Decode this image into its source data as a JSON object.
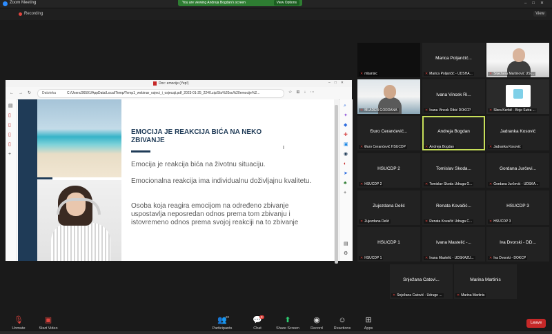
{
  "window": {
    "title": "Zoom Meeting"
  },
  "banner": {
    "text": "You are viewing Andreja Bogdan's screen",
    "view_options": "View Options"
  },
  "recording": {
    "label": "Recording",
    "view_label": "View"
  },
  "shared_browser": {
    "tab_title": "Doc: emocije (Yep!)",
    "address_label": "Datoteka",
    "url": "C:/Users/36591/AppData/Local/Temp/Temp1_webinar_osjeci_i_osjecaji.pdf_2023-01-25_2240.zip/Sto%20su%20emocije%2...",
    "slide": {
      "heading": "EMOCIJA JE REAKCIJA BIĆA NA NEKO ZBIVANJE",
      "p1": "Emocija je reakcija bića na životnu situaciju.",
      "p2": "Emocionalna reakcija ima individualnu doživljajnu kvalitetu.",
      "p3": "Osoba koja reagira emocijom na određeno zbivanje uspostavlja neposredan odnos prema tom zbivanju i istovremeno odnos prema svojoj reakciji na to zbivanje"
    }
  },
  "participants": [
    {
      "name": "",
      "label": "mbarisic",
      "video": "vid1"
    },
    {
      "name": "Marica Poljančić...",
      "label": "Marica Poljančić - UDSHA...",
      "video": ""
    },
    {
      "name": "",
      "label": "Snježana Martinović ÚSI...",
      "video": "vid2"
    },
    {
      "name": "",
      "label": "MLADEN GORDANA",
      "video": "vid3"
    },
    {
      "name": "Ivana Vincek Ri...",
      "label": "Ivana Vincek Ribić DOKCP",
      "video": ""
    },
    {
      "name": "",
      "label": "Slora Kerbić - Boje Sutra ...",
      "video": "vid4"
    },
    {
      "name": "Đuro Ceranćević...",
      "label": "Đuro Ceranćević HSUCDP",
      "video": ""
    },
    {
      "name": "Andreja Bogdan",
      "label": "Andreja Bogdan",
      "video": "sel"
    },
    {
      "name": "Jadranka Kosović",
      "label": "Jadranka Kosović",
      "video": ""
    },
    {
      "name": "HSUCDP 2",
      "label": "HSUCDP 2",
      "video": ""
    },
    {
      "name": "Tomislav Škoda...",
      "label": "Tomislav Škoda Udruga O...",
      "video": ""
    },
    {
      "name": "Gordana Jurčevi...",
      "label": "Gordana Jurčević - UDSKA...",
      "video": ""
    },
    {
      "name": "Zujezdana Delić",
      "label": "Zujezdana Delić",
      "video": ""
    },
    {
      "name": "Renata Kovačić...",
      "label": "Renata Kovačić Udruga C...",
      "video": ""
    },
    {
      "name": "HSUCDP 3",
      "label": "HSUCDP 3",
      "video": ""
    },
    {
      "name": "HSUCDP 1",
      "label": "HSUCDP 1",
      "video": ""
    },
    {
      "name": "Ivana Mastelić -...",
      "label": "Ivana Mastelić - UDSKAŽU...",
      "video": ""
    },
    {
      "name": "Iva Dvorski - DD...",
      "label": "Iva Dvorski - DOKCP",
      "video": ""
    },
    {
      "name": "Snježana Čatovi...",
      "label": "Snježana Čatović - Udruge ...",
      "video": ""
    },
    {
      "name": "Marina Martinis",
      "label": "Marina Martinis",
      "video": ""
    }
  ],
  "controls": {
    "unmute": "Unmute",
    "start_video": "Start Video",
    "participants": "Participants",
    "participants_count": "20",
    "chat": "Chat",
    "chat_badge": "3",
    "share_screen": "Share Screen",
    "record": "Record",
    "reactions": "Reactions",
    "apps": "Apps",
    "leave": "Leave"
  }
}
